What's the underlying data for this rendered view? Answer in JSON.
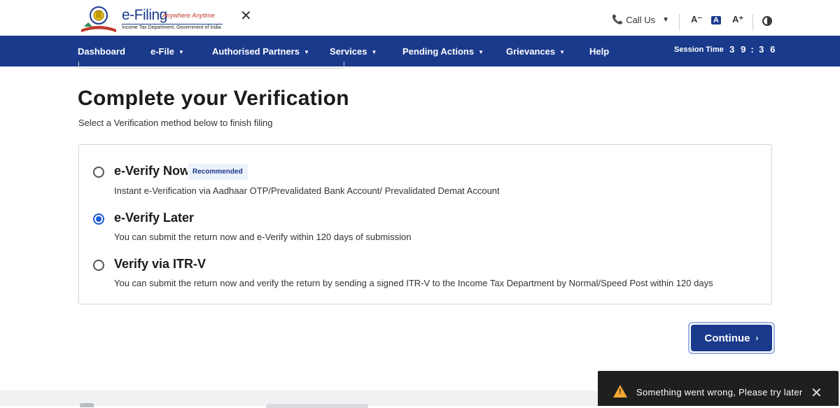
{
  "header": {
    "logo_title": "e-Filing",
    "logo_tag": "Anywhere Anytime",
    "logo_sub": "Income Tax Department, Government of India",
    "call_us": "Call Us",
    "font_decrease": "A⁻",
    "font_reset": "A",
    "font_increase": "A⁺"
  },
  "nav": {
    "items": [
      {
        "label": "Dashboard"
      },
      {
        "label": "e-File"
      },
      {
        "label": "Authorised Partners"
      },
      {
        "label": "Services"
      },
      {
        "label": "Pending Actions"
      },
      {
        "label": "Grievances"
      },
      {
        "label": "Help"
      }
    ],
    "session_label": "Session Time",
    "session_digits": [
      "3",
      "9",
      ":",
      "3",
      "6"
    ]
  },
  "main": {
    "title": "Complete your Verification",
    "subtitle": "Select a Verification method below to finish filing",
    "options": [
      {
        "title": "e-Verify Now",
        "badge": "Recommended",
        "desc": "Instant e-Verification via Aadhaar OTP/Prevalidated Bank Account/ Prevalidated Demat Account",
        "selected": false
      },
      {
        "title": "e-Verify Later",
        "desc": "You can submit the return now and e-Verify within 120 days of submission",
        "selected": true
      },
      {
        "title": "Verify via ITR-V",
        "desc": "You can submit the return now and verify the return by sending a signed ITR-V to the Income Tax Department by Normal/Speed Post within 120 days",
        "selected": false
      }
    ],
    "continue_label": "Continue"
  },
  "toast": {
    "message": "Something went wrong, Please try later"
  },
  "colors": {
    "brand_blue": "#1a3a8c",
    "radio_selected": "#1a5bd8",
    "toast_bg": "#1f1f1f",
    "warning": "#f0a830"
  }
}
